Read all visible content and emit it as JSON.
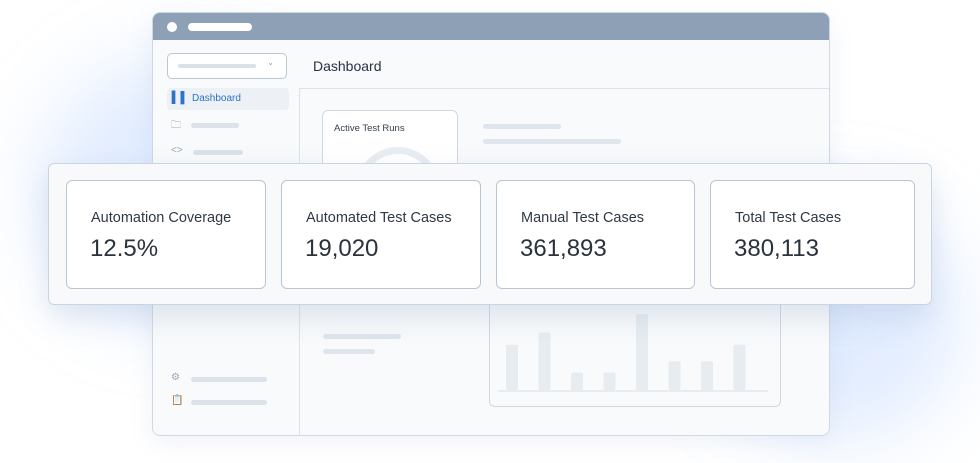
{
  "window": {
    "header_title": "Dashboard",
    "sidebar": {
      "active_item": {
        "icon": "bar-chart-icon",
        "label": "Dashboard"
      },
      "nav_icons": [
        "folder-icon",
        "code-icon"
      ],
      "bottom_icons": [
        "gear-icon",
        "clipboard-icon"
      ]
    },
    "widget": {
      "active_test_runs_label": "Active Test Runs"
    },
    "colors": {
      "accent": "#2a73c9",
      "titlebar": "#8ea0b5"
    }
  },
  "stats": [
    {
      "label": "Automation Coverage",
      "value": "12.5%"
    },
    {
      "label": "Automated Test Cases",
      "value": "19,020"
    },
    {
      "label": "Manual Test Cases",
      "value": "361,893"
    },
    {
      "label": "Total Test Cases",
      "value": "380,113"
    }
  ],
  "chart_data": {
    "type": "bar",
    "values": [
      44,
      56,
      17,
      17,
      74,
      28,
      28,
      44
    ]
  }
}
